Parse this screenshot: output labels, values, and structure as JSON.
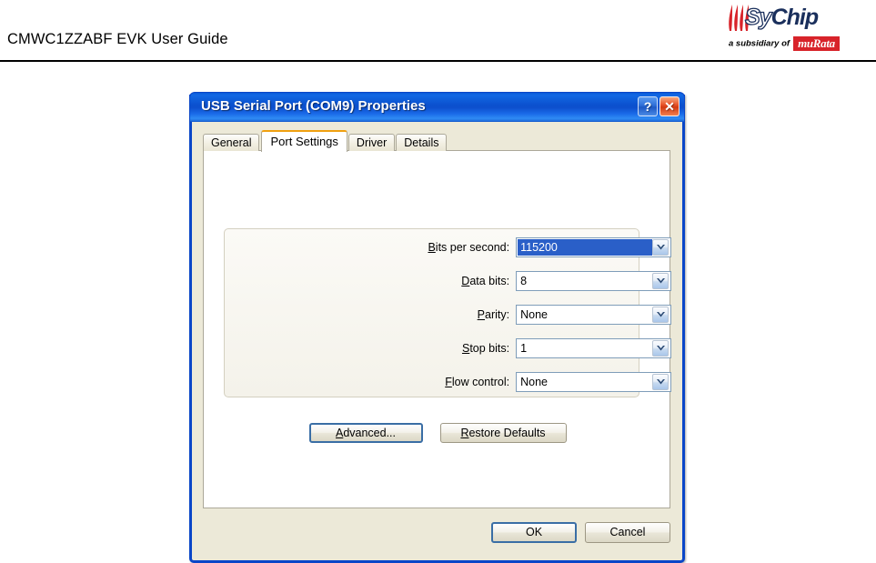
{
  "page": {
    "header_title": "CMWC1ZZABF EVK User Guide",
    "logo": {
      "brand_part1": "Sy",
      "brand_part2": "Chip",
      "subsidiary_text": "a subsidiary of",
      "parent_brand": "muRata",
      "parent_brand_color": "#d8232a",
      "brand_color": "#1a2f5c"
    }
  },
  "dialog": {
    "title": "USB Serial Port (COM9) Properties",
    "titlebar_color": "#0b51cf",
    "titlebar_buttons": [
      {
        "name": "help",
        "glyph": "?"
      },
      {
        "name": "close",
        "glyph": "✕"
      }
    ],
    "tabs": [
      {
        "label": "General",
        "active": false
      },
      {
        "label": "Port Settings",
        "active": true
      },
      {
        "label": "Driver",
        "active": false
      },
      {
        "label": "Details",
        "active": false
      }
    ],
    "active_tab_accent": "#f0a010",
    "settings": [
      {
        "label_pre": "B",
        "label_post": "its per second:",
        "value": "115200",
        "selected": true
      },
      {
        "label_pre": "D",
        "label_post": "ata bits:",
        "value": "8",
        "selected": false
      },
      {
        "label_pre": "P",
        "label_post": "arity:",
        "value": "None",
        "selected": false
      },
      {
        "label_pre": "S",
        "label_post": "top bits:",
        "value": "1",
        "selected": false
      },
      {
        "label_pre": "F",
        "label_post": "low control:",
        "value": "None",
        "selected": false
      }
    ],
    "selection_color": "#2a5fc8",
    "mid_buttons": [
      {
        "pre": "",
        "key": "A",
        "post": "dvanced...",
        "focused": true
      },
      {
        "pre": "",
        "key": "R",
        "post": "estore Defaults",
        "focused": false
      }
    ],
    "footer_buttons": [
      {
        "label": "OK",
        "default": true
      },
      {
        "label": "Cancel",
        "default": false
      }
    ]
  }
}
